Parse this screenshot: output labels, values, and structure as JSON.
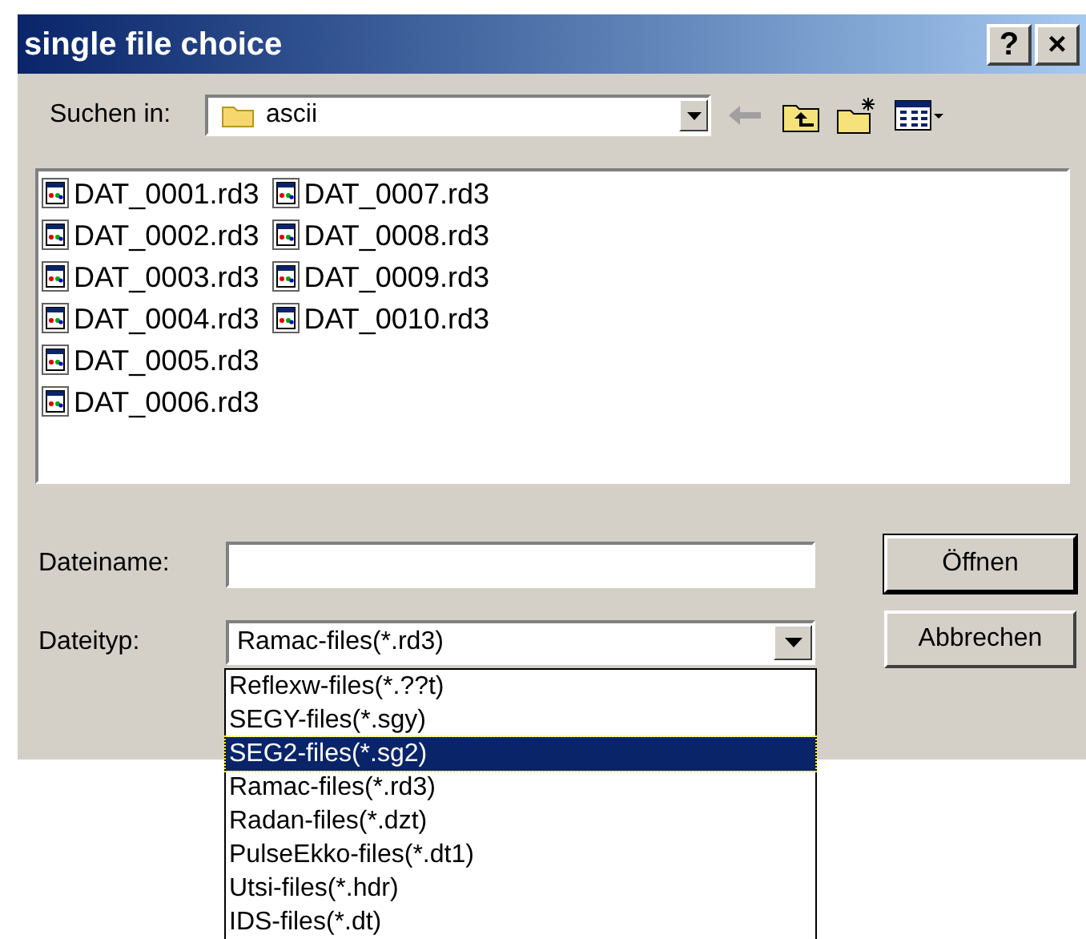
{
  "window": {
    "title": "single file choice",
    "buttons": [
      "?",
      "×"
    ]
  },
  "look_in": {
    "label": "Suchen in:",
    "value": "ascii"
  },
  "files": [
    {
      "name": "DAT_0001.rd3"
    },
    {
      "name": "DAT_0002.rd3"
    },
    {
      "name": "DAT_0003.rd3"
    },
    {
      "name": "DAT_0004.rd3"
    },
    {
      "name": "DAT_0005.rd3"
    },
    {
      "name": "DAT_0006.rd3"
    },
    {
      "name": "DAT_0007.rd3"
    },
    {
      "name": "DAT_0008.rd3"
    },
    {
      "name": "DAT_0009.rd3"
    },
    {
      "name": "DAT_0010.rd3"
    }
  ],
  "filename": {
    "label": "Dateiname:"
  },
  "filetype": {
    "label": "Dateityp:",
    "value": "Ramac-files(*.rd3)",
    "expanded": true,
    "options": [
      {
        "label": "Reflexw-files(*.??t)",
        "highlighted": false
      },
      {
        "label": "SEGY-files(*.sgy)",
        "highlighted": false
      },
      {
        "label": "SEG2-files(*.sg2)",
        "highlighted": true
      },
      {
        "label": "Ramac-files(*.rd3)",
        "highlighted": false
      },
      {
        "label": "Radan-files(*.dzt)",
        "highlighted": false
      },
      {
        "label": "PulseEkko-files(*.dt1)",
        "highlighted": false
      },
      {
        "label": "Utsi-files(*.hdr)",
        "highlighted": false
      },
      {
        "label": "IDS-files(*.dt)",
        "highlighted": false
      }
    ]
  },
  "buttons": [
    "Öffnen",
    "Abbrechen"
  ]
}
